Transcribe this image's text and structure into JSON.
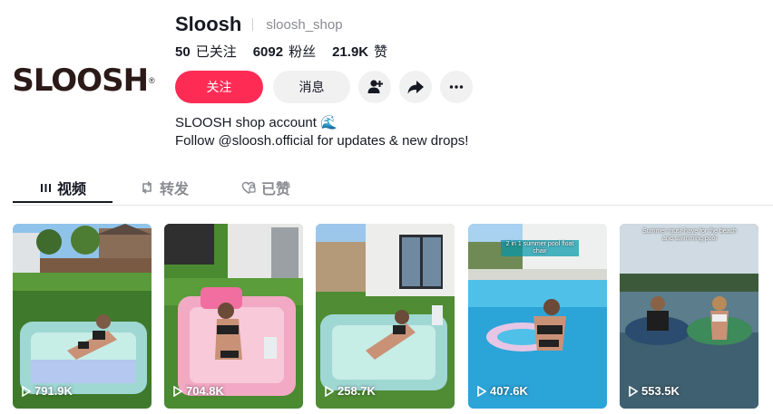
{
  "profile": {
    "logo_text": "SLOOSH",
    "name": "Sloosh",
    "handle": "sloosh_shop",
    "stats": [
      {
        "value": "50",
        "label": "已关注"
      },
      {
        "value": "6092",
        "label": "粉丝"
      },
      {
        "value": "21.9K",
        "label": "赞"
      }
    ],
    "follow_label": "关注",
    "message_label": "消息",
    "bio_line1": "SLOOSH shop account 🌊",
    "bio_line2": "Follow @sloosh.official for updates & new drops!"
  },
  "tabs": [
    {
      "label": "视频",
      "icon": "grid-icon",
      "active": true
    },
    {
      "label": "转发",
      "icon": "repost-icon",
      "active": false
    },
    {
      "label": "已赞",
      "icon": "liked-heart-icon",
      "active": false
    }
  ],
  "videos": [
    {
      "views": "791.9K",
      "caption": ""
    },
    {
      "views": "704.8K",
      "caption": ""
    },
    {
      "views": "258.7K",
      "caption": ""
    },
    {
      "views": "407.6K",
      "caption": "2 in 1 summer pool float chair"
    },
    {
      "views": "553.5K",
      "caption": "Summer must-have for the beach and swimming pool"
    }
  ],
  "colors": {
    "accent": "#fe2c55",
    "text": "#161823",
    "muted": "#8a8b91",
    "chip": "#f1f1f2"
  }
}
